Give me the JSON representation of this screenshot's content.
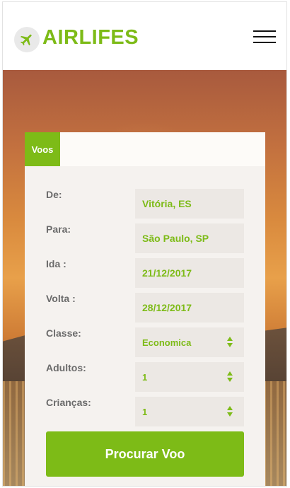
{
  "header": {
    "brand": "AIRLIFES",
    "logo_icon": "plane-icon",
    "menu_icon": "hamburger-menu-icon"
  },
  "search": {
    "tab_label": "Voos",
    "fields": {
      "from": {
        "label": "De:",
        "value": "Vitória, ES"
      },
      "to": {
        "label": "Para:",
        "value": "São Paulo, SP"
      },
      "departure": {
        "label": "Ida :",
        "value": "21/12/2017"
      },
      "return": {
        "label": "Volta :",
        "value": "28/12/2017"
      },
      "class": {
        "label": "Classe:",
        "value": "Economica"
      },
      "adults": {
        "label": "Adultos:",
        "value": "1"
      },
      "children": {
        "label": "Crianças:",
        "value": "1"
      }
    },
    "submit_label": "Procurar Voo"
  },
  "colors": {
    "accent": "#7dbb17",
    "field_bg": "#ece8e4",
    "label_text": "#6b6b6b"
  }
}
